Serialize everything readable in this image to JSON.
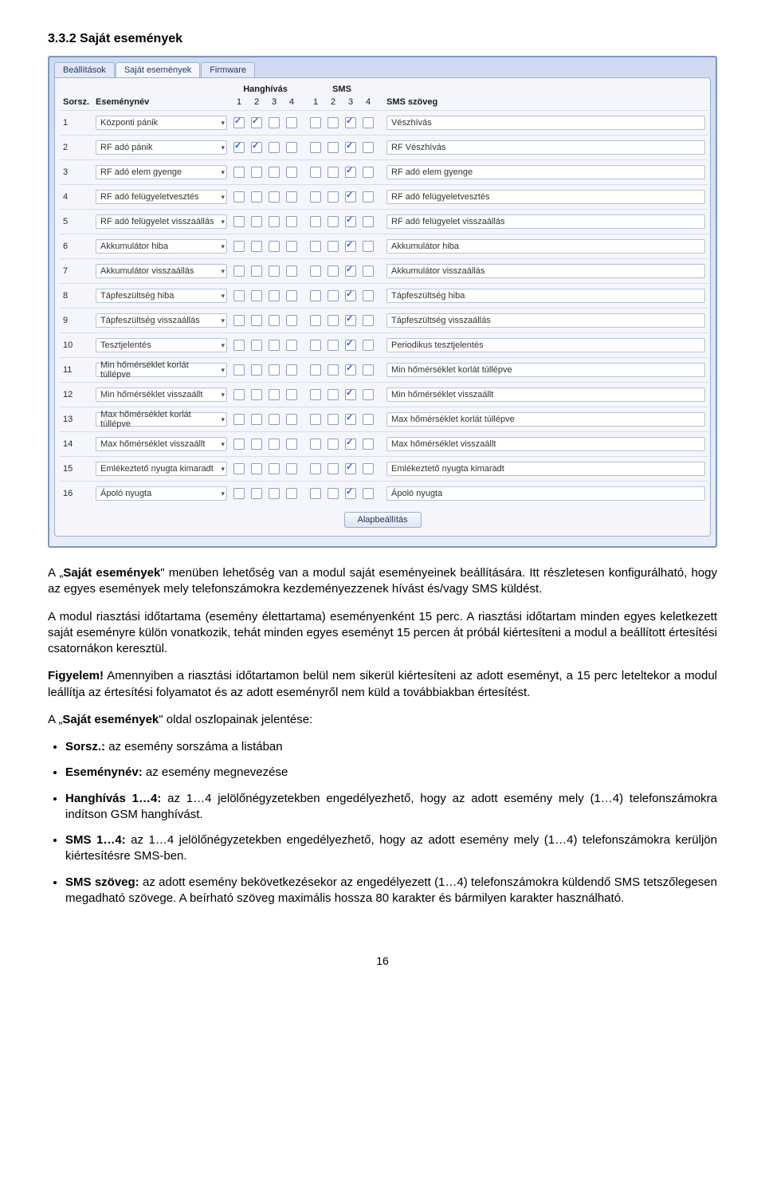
{
  "heading": "3.3.2  Saját események",
  "tabs": [
    "Beállítások",
    "Saját események",
    "Firmware"
  ],
  "activeTab": 1,
  "headers": {
    "sorsz": "Sorsz.",
    "esemeny": "Eseménynév",
    "hanghivas": "Hanghívás",
    "sms": "SMS",
    "smsszoveg": "SMS szöveg",
    "sub": [
      "1",
      "2",
      "3",
      "4"
    ]
  },
  "rows": [
    {
      "n": "1",
      "name": "Központi pánik",
      "h": [
        1,
        1,
        0,
        0
      ],
      "s": [
        0,
        0,
        1,
        0
      ],
      "smstext": "Vészhívás"
    },
    {
      "n": "2",
      "name": "RF adó pánik",
      "h": [
        1,
        1,
        0,
        0
      ],
      "s": [
        0,
        0,
        1,
        0
      ],
      "smstext": "RF Vészhívás"
    },
    {
      "n": "3",
      "name": "RF adó elem gyenge",
      "h": [
        0,
        0,
        0,
        0
      ],
      "s": [
        0,
        0,
        1,
        0
      ],
      "smstext": "RF adó elem gyenge"
    },
    {
      "n": "4",
      "name": "RF adó felügyeletvesztés",
      "h": [
        0,
        0,
        0,
        0
      ],
      "s": [
        0,
        0,
        1,
        0
      ],
      "smstext": "RF adó felügyeletvesztés"
    },
    {
      "n": "5",
      "name": "RF adó felügyelet visszaállás",
      "h": [
        0,
        0,
        0,
        0
      ],
      "s": [
        0,
        0,
        1,
        0
      ],
      "smstext": "RF adó felügyelet visszaállás"
    },
    {
      "n": "6",
      "name": "Akkumulátor hiba",
      "h": [
        0,
        0,
        0,
        0
      ],
      "s": [
        0,
        0,
        1,
        0
      ],
      "smstext": "Akkumulátor hiba"
    },
    {
      "n": "7",
      "name": "Akkumulátor visszaállás",
      "h": [
        0,
        0,
        0,
        0
      ],
      "s": [
        0,
        0,
        1,
        0
      ],
      "smstext": "Akkumulátor visszaállás"
    },
    {
      "n": "8",
      "name": "Tápfeszültség hiba",
      "h": [
        0,
        0,
        0,
        0
      ],
      "s": [
        0,
        0,
        1,
        0
      ],
      "smstext": "Tápfeszültség hiba"
    },
    {
      "n": "9",
      "name": "Tápfeszültség visszaállás",
      "h": [
        0,
        0,
        0,
        0
      ],
      "s": [
        0,
        0,
        1,
        0
      ],
      "smstext": "Tápfeszültség visszaállás"
    },
    {
      "n": "10",
      "name": "Tesztjelentés",
      "h": [
        0,
        0,
        0,
        0
      ],
      "s": [
        0,
        0,
        1,
        0
      ],
      "smstext": "Periodikus tesztjelentés"
    },
    {
      "n": "11",
      "name": "Min hőmérséklet korlát túllépve",
      "h": [
        0,
        0,
        0,
        0
      ],
      "s": [
        0,
        0,
        1,
        0
      ],
      "smstext": "Min hőmérséklet korlát túllépve"
    },
    {
      "n": "12",
      "name": "Min hőmérséklet visszaállt",
      "h": [
        0,
        0,
        0,
        0
      ],
      "s": [
        0,
        0,
        1,
        0
      ],
      "smstext": "Min hőmérséklet visszaállt"
    },
    {
      "n": "13",
      "name": "Max hőmérséklet korlát túllépve",
      "h": [
        0,
        0,
        0,
        0
      ],
      "s": [
        0,
        0,
        1,
        0
      ],
      "smstext": "Max hőmérséklet korlát túllépve"
    },
    {
      "n": "14",
      "name": "Max hőmérséklet visszaállt",
      "h": [
        0,
        0,
        0,
        0
      ],
      "s": [
        0,
        0,
        1,
        0
      ],
      "smstext": "Max hőmérséklet visszaállt"
    },
    {
      "n": "15",
      "name": "Emlékeztető nyugta kimaradt",
      "h": [
        0,
        0,
        0,
        0
      ],
      "s": [
        0,
        0,
        1,
        0
      ],
      "smstext": "Emlékeztető nyugta kimaradt"
    },
    {
      "n": "16",
      "name": "Ápoló nyugta",
      "h": [
        0,
        0,
        0,
        0
      ],
      "s": [
        0,
        0,
        1,
        0
      ],
      "smstext": "Ápoló nyugta"
    }
  ],
  "resetBtn": "Alapbeállítás",
  "body": {
    "p1a": "A „",
    "p1bold": "Saját események",
    "p1b": "\" menüben lehetőség van a modul saját eseményeinek beállítására. Itt részletesen konfigurálható, hogy az egyes események mely telefonszámokra kezdeményezzenek hívást és/vagy SMS küldést.",
    "p2": "A modul riasztási időtartama (esemény élettartama) eseményenként 15 perc. A riasztási időtartam minden egyes keletkezett saját eseményre külön vonatkozik, tehát minden egyes eseményt 15 percen át próbál kiértesíteni a modul a beállított értesítési csatornákon keresztül.",
    "p3bold": "Figyelem!",
    "p3": " Amennyiben a riasztási időtartamon belül nem sikerül kiértesíteni az adott eseményt, a 15 perc leteltekor a modul leállítja az értesítési folyamatot és az adott eseményről nem küld a továbbiakban értesítést.",
    "p4a": "A „",
    "p4bold": "Saját események",
    "p4b": "\" oldal oszlopainak jelentése:",
    "li1bold": "Sorsz.:",
    "li1": "  az esemény sorszáma a listában",
    "li2bold": "Eseménynév:",
    "li2": " az esemény megnevezése",
    "li3bold": "Hanghívás 1…4:",
    "li3": " az 1…4 jelölőnégyzetekben engedélyezhető, hogy az adott esemény mely (1…4) telefonszámokra indítson GSM hanghívást.",
    "li4bold": "SMS 1…4:",
    "li4": " az 1…4 jelölőnégyzetekben engedélyezhető, hogy az adott esemény mely (1…4) telefonszámokra kerüljön kiértesítésre SMS-ben.",
    "li5bold": "SMS szöveg:",
    "li5": " az adott esemény bekövetkezésekor az engedélyezett (1…4) telefonszámokra küldendő SMS tetszőlegesen megadható szövege. A beírható szöveg maximális hossza 80 karakter és bármilyen karakter használható."
  },
  "pagenum": "16"
}
